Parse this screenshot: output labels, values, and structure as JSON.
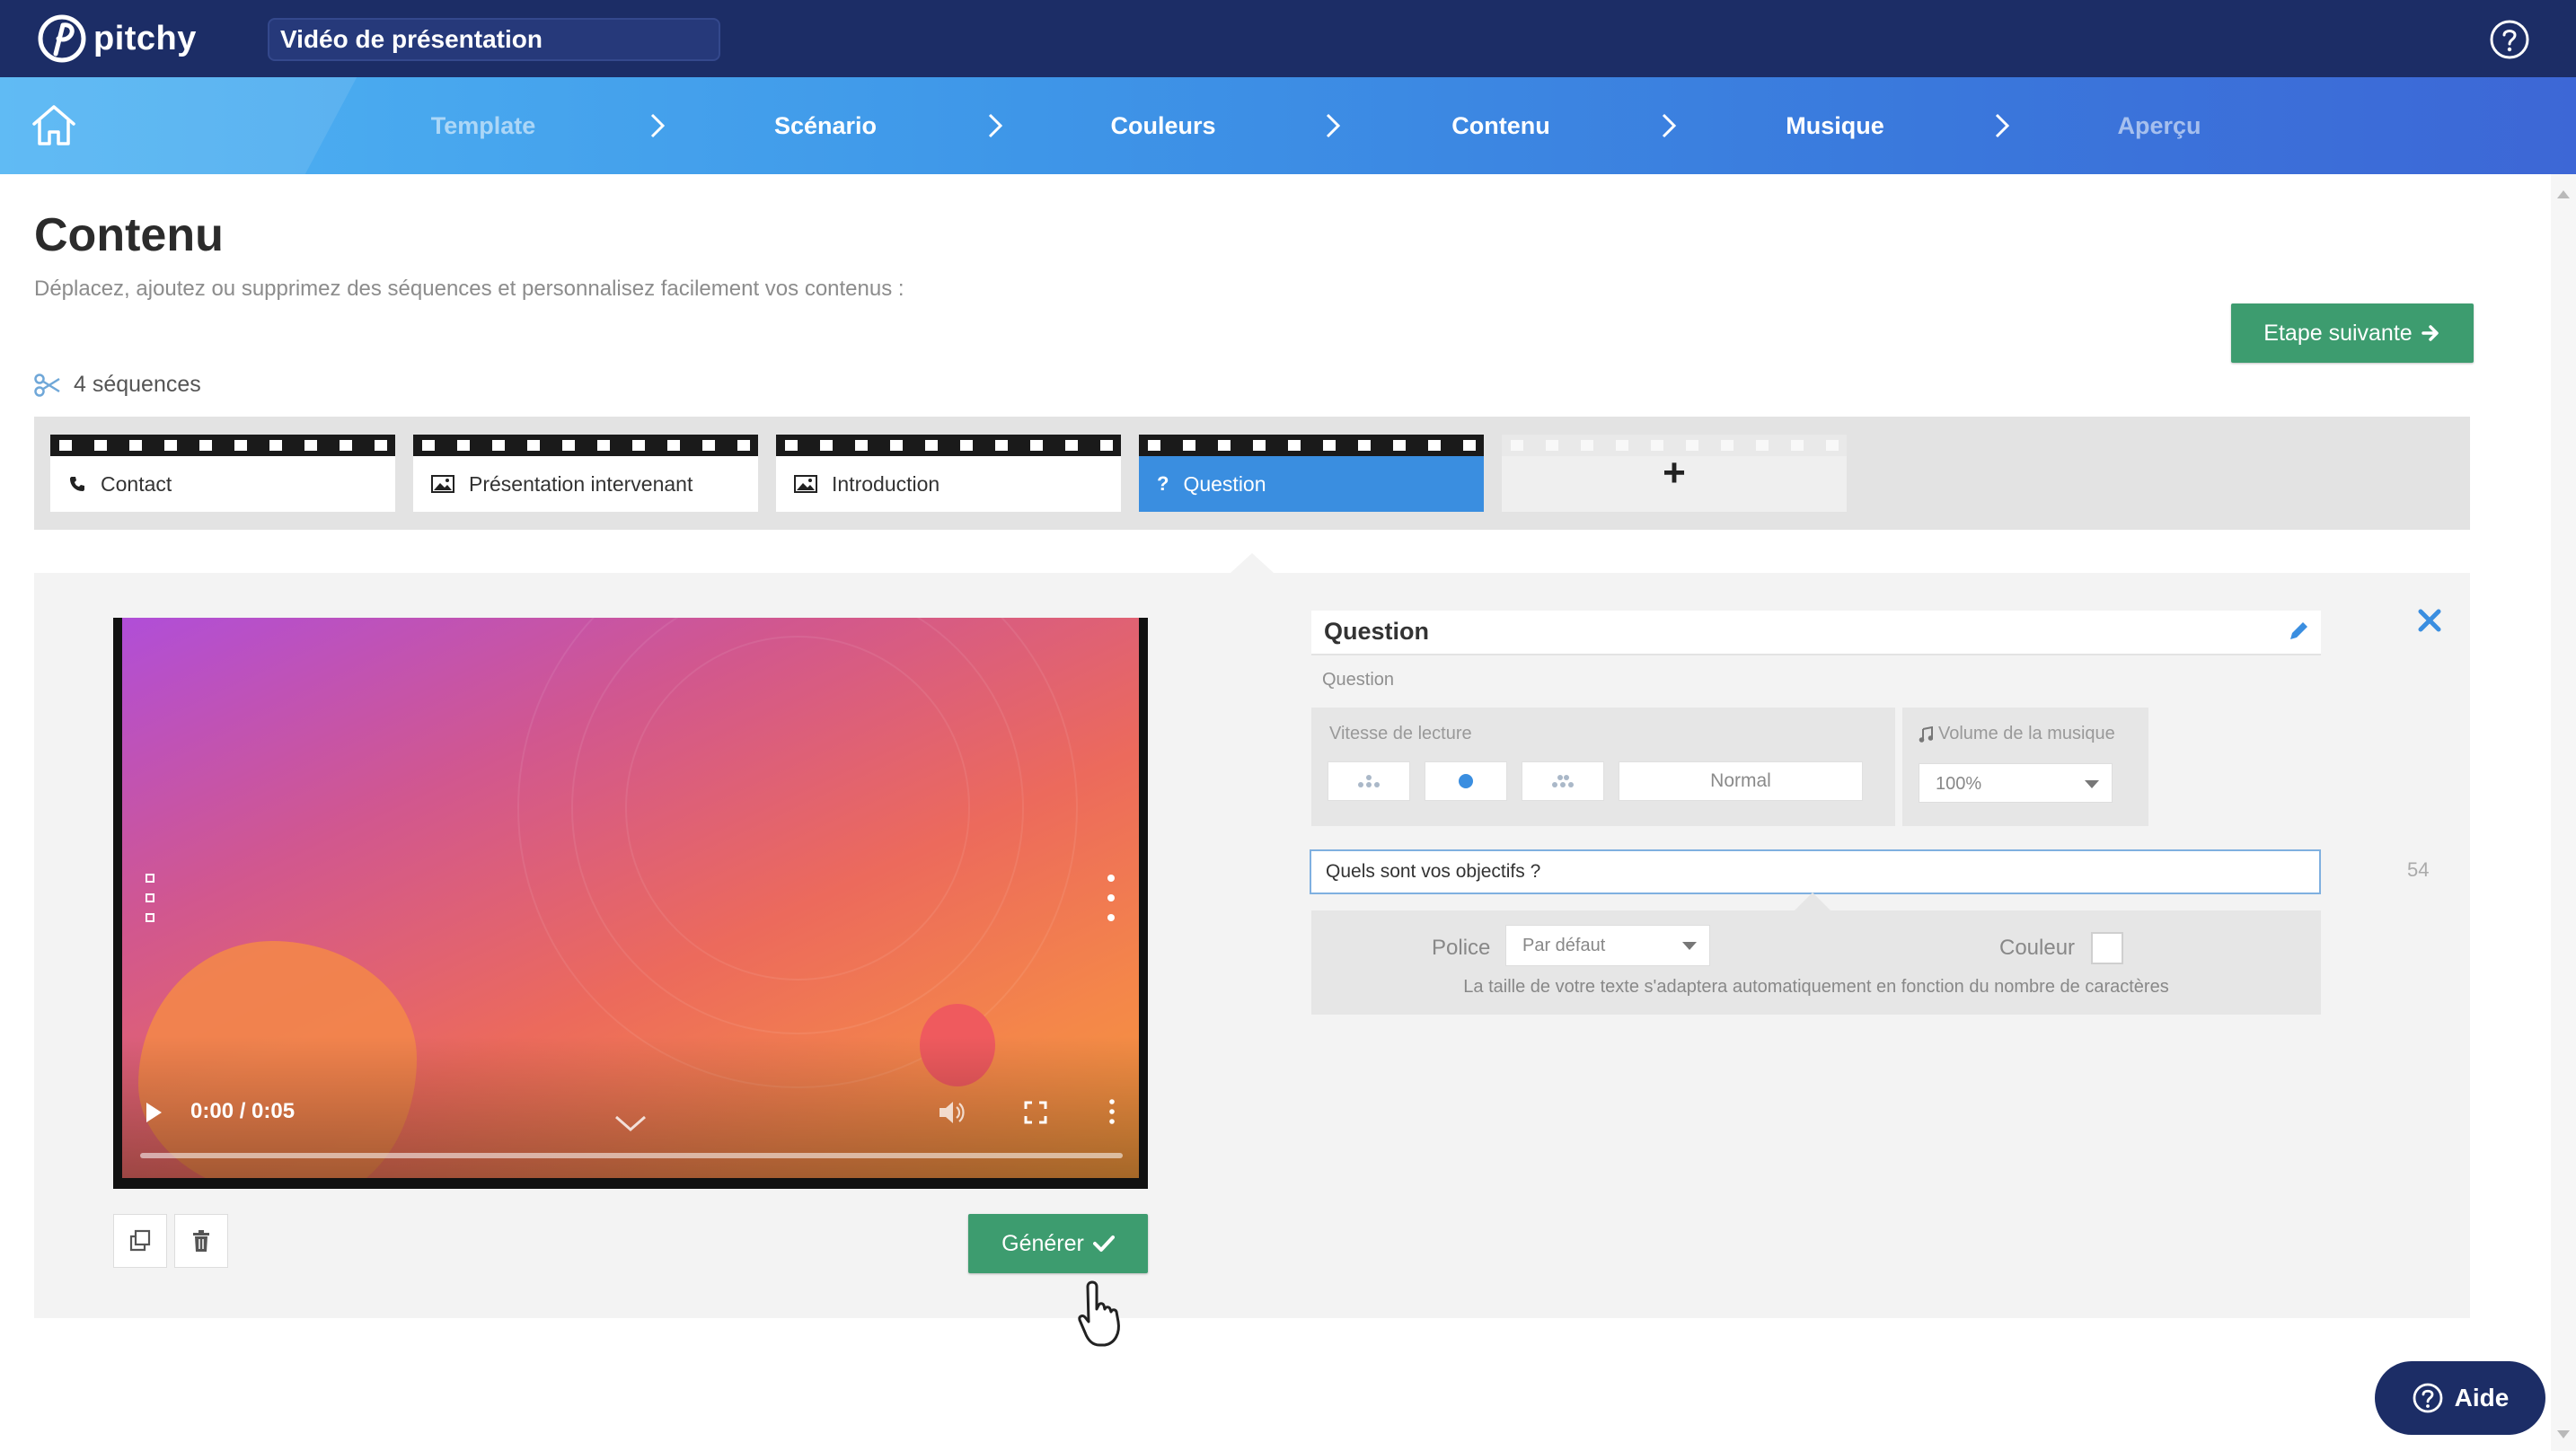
{
  "app": {
    "logo_text": "pitchy",
    "project_title": "Vidéo de présentation"
  },
  "steps": [
    {
      "label": "Template",
      "state": "muted"
    },
    {
      "label": "Scénario",
      "state": "done"
    },
    {
      "label": "Couleurs",
      "state": "done"
    },
    {
      "label": "Contenu",
      "state": "active"
    },
    {
      "label": "Musique",
      "state": "done"
    },
    {
      "label": "Aperçu",
      "state": "muted"
    }
  ],
  "header": {
    "title": "Contenu",
    "subtitle": "Déplacez, ajoutez ou supprimez des séquences et personnalisez facilement vos contenus :",
    "next_label": "Etape suivante",
    "sequence_count": "4 séquences"
  },
  "sequences": [
    {
      "label": "Contact",
      "icon": "phone-icon"
    },
    {
      "label": "Présentation intervenant",
      "icon": "image-icon"
    },
    {
      "label": "Introduction",
      "icon": "image-icon"
    },
    {
      "label": "Question",
      "icon": "question-icon",
      "active": true
    }
  ],
  "add_sequence_symbol": "+",
  "player": {
    "time": "0:00 / 0:05",
    "progress": 0
  },
  "actions": {
    "generate_label": "Générer"
  },
  "editor": {
    "title": "Question",
    "subtitle": "Question",
    "speed_label": "Vitesse de lecture",
    "speed_value": "Normal",
    "volume_label": "Volume de la musique",
    "volume_value": "100%",
    "question_text": "Quels sont vos objectifs ?",
    "char_count": "54",
    "police_label": "Police",
    "police_value": "Par défaut",
    "couleur_label": "Couleur",
    "hint": "La taille de votre texte s'adaptera automatiquement en fonction du nombre de caractères"
  },
  "help": {
    "label": "Aide"
  },
  "colors": {
    "topbar": "#1c2d66",
    "accent_green": "#3d9c6f",
    "active_blue": "#3a8ee0"
  }
}
